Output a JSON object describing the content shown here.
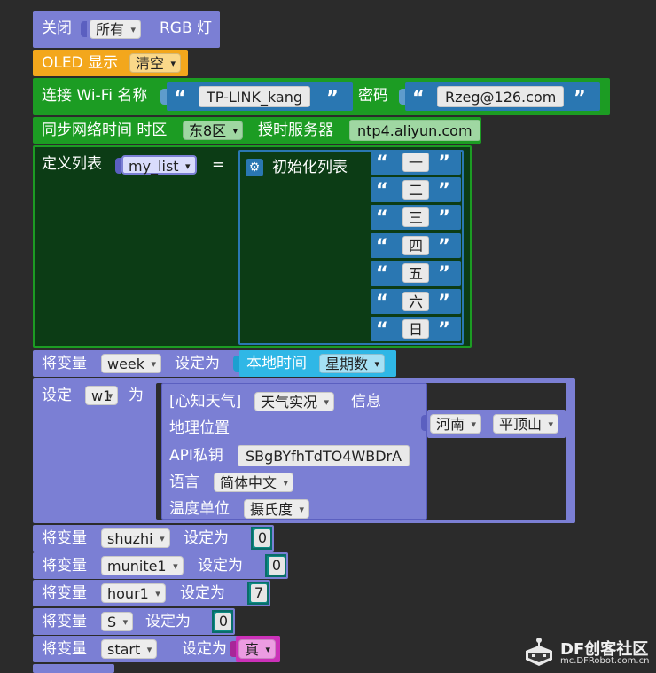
{
  "rgb_block": {
    "label_close": "关闭",
    "dropdown": "所有",
    "label_rgb": "RGB 灯"
  },
  "oled_block": {
    "label": "OLED 显示",
    "dropdown": "清空"
  },
  "wifi_block": {
    "label_connect": "连接 Wi-Fi 名称",
    "ssid": "TP-LINK_kang",
    "label_password": "密码",
    "password": "Rzeg@126.com"
  },
  "ntp_block": {
    "label_sync": "同步网络时间 时区",
    "timezone": "东8区",
    "label_server": "授时服务器",
    "server": "ntp4.aliyun.com"
  },
  "list_block": {
    "label_define": "定义列表",
    "var_name": "my_list",
    "equals": "=",
    "init_label": "初始化列表",
    "open_quote": "“",
    "close_quote": "”",
    "items": [
      "一",
      "二",
      "三",
      "四",
      "五",
      "六",
      "日"
    ]
  },
  "week_block": {
    "label_set": "将变量",
    "var_name": "week",
    "label_as": "设定为",
    "local_time": "本地时间",
    "time_field": "星期数"
  },
  "weather_block": {
    "label_set": "设定",
    "var_name": "w1",
    "label_as": "为",
    "source_label": "[心知天气]",
    "type_dropdown": "天气实况",
    "info_label": "信息",
    "location_label": "地理位置",
    "province": "河南",
    "city": "平顶山",
    "api_label": "API私钥",
    "api_key": "SBgBYfhTdTO4WBDrA",
    "lang_label": "语言",
    "lang_value": "简体中文",
    "temp_label": "温度单位",
    "temp_value": "摄氏度"
  },
  "variables": [
    {
      "label_set": "将变量",
      "name": "shuzhi",
      "label_as": "设定为",
      "value": "0"
    },
    {
      "label_set": "将变量",
      "name": "munite1",
      "label_as": "设定为",
      "value": "0"
    },
    {
      "label_set": "将变量",
      "name": "hour1",
      "label_as": "设定为",
      "value": "7"
    },
    {
      "label_set": "将变量",
      "name": "S",
      "label_as": "设定为",
      "value": "0"
    },
    {
      "label_set": "将变量",
      "name": "start",
      "label_as": "设定为",
      "value": "真"
    }
  ],
  "watermark": {
    "brand": "DF创客社区",
    "url": "mc.DFRobot.com.cn"
  },
  "colors": {
    "purple": "#7b7fd4",
    "orange": "#f3a71c",
    "green": "#1c9c23",
    "dark_green": "#0c3c15",
    "blue": "#2a77b2",
    "cyan": "#2fb7e6",
    "teal": "#0c8a84",
    "magenta": "#cc31b9"
  }
}
